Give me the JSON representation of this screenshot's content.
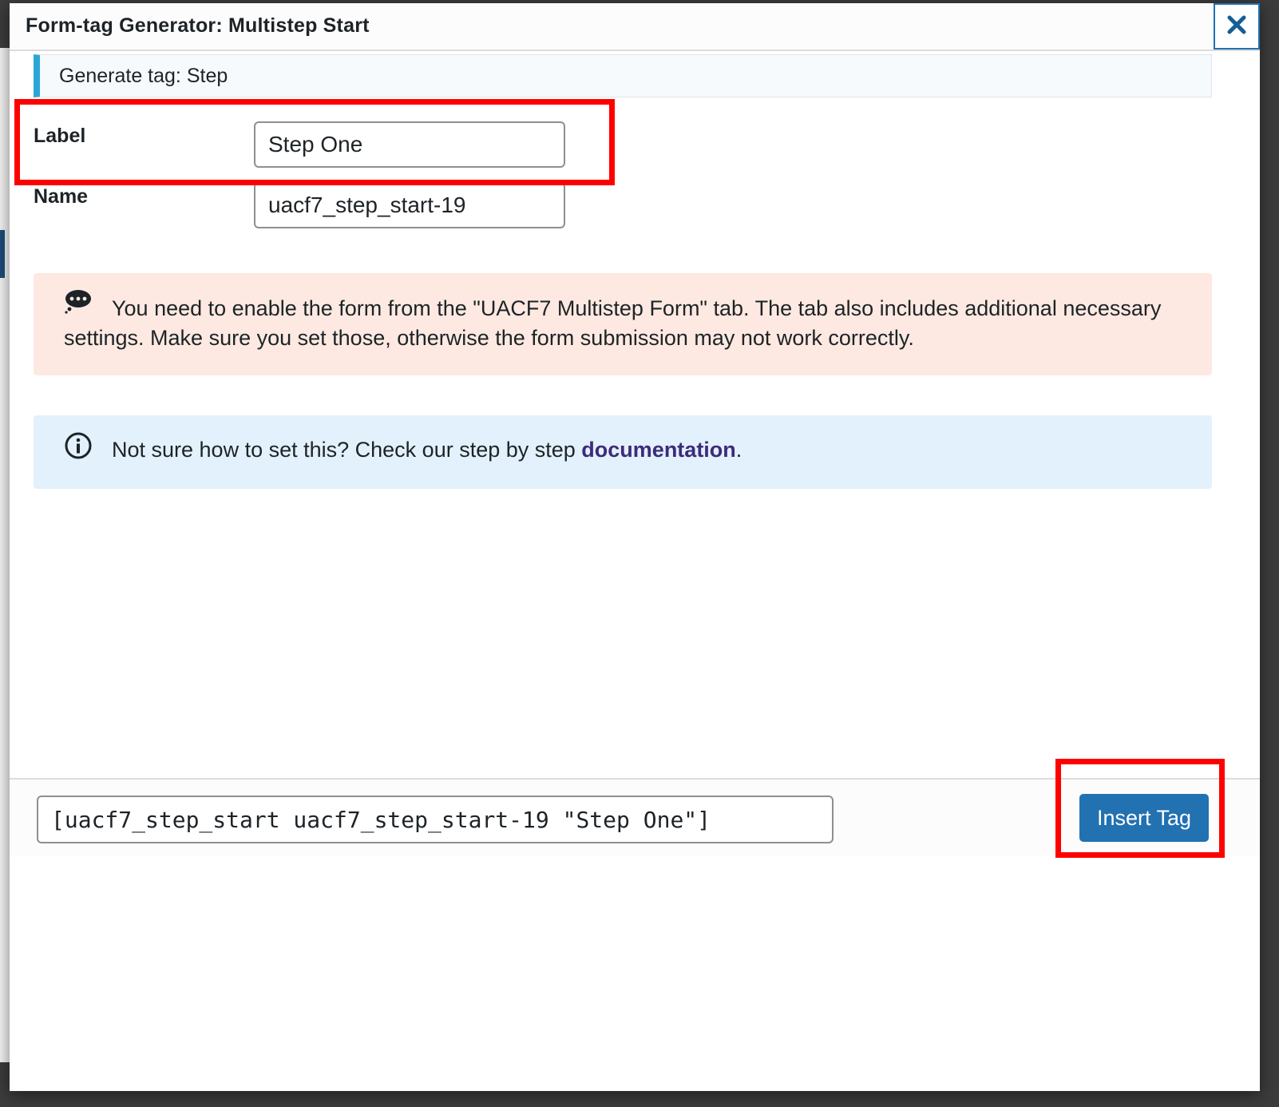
{
  "dialog": {
    "title": "Form-tag Generator: Multistep Start",
    "close_icon": "close-icon"
  },
  "generate_notice": {
    "text": "Generate tag: Step"
  },
  "fields": {
    "label": {
      "label": "Label",
      "value": "Step One"
    },
    "name": {
      "label": "Name",
      "value": "uacf7_step_start-19"
    }
  },
  "warning": {
    "icon": "chat-bubble-icon",
    "text": "You need to enable the form from the \"UACF7 Multistep Form\" tab. The tab also includes additional necessary settings. Make sure you set those, otherwise the form submission may not work correctly."
  },
  "info": {
    "icon": "info-icon",
    "text_before": "Not sure how to set this? Check our step by step ",
    "link_text": "documentation",
    "text_after": "."
  },
  "footer": {
    "tag_value": "[uacf7_step_start uacf7_step_start-19 \"Step One\"]",
    "insert_button": "Insert Tag"
  },
  "colors": {
    "accent": "#2271b1",
    "warning_bg": "#fde9e1",
    "info_bg": "#e2f1fb",
    "highlight": "#ff0000",
    "link": "#3d2b7a"
  }
}
